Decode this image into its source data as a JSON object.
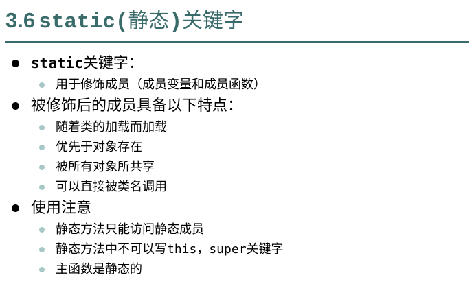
{
  "slide": {
    "title": {
      "number": "3.6",
      "code": "static(",
      "cjk1": "静态",
      "code2": ")",
      "cjk2": "关键字"
    },
    "sections": [
      {
        "code": "static",
        "label": "关键字：",
        "items": [
          {
            "text": "用于修饰成员（成员变量和成员函数）"
          }
        ]
      },
      {
        "label": "被修饰后的成员具备以下特点：",
        "items": [
          {
            "text": "随着类的加载而加载"
          },
          {
            "text": "优先于对象存在"
          },
          {
            "text": "被所有对象所共享"
          },
          {
            "text": "可以直接被类名调用"
          }
        ]
      },
      {
        "label": "使用注意",
        "items": [
          {
            "text": "静态方法只能访问静态成员"
          },
          {
            "text": "静态方法中不可以写",
            "code": "this，super",
            "suffix": "关键字"
          },
          {
            "text": "主函数是静态的"
          }
        ]
      }
    ]
  },
  "colors": {
    "title": "#3a6b6b",
    "rule": "#3a6b6b",
    "sub_bullet": "#a8c8c8",
    "text": "#000000"
  }
}
